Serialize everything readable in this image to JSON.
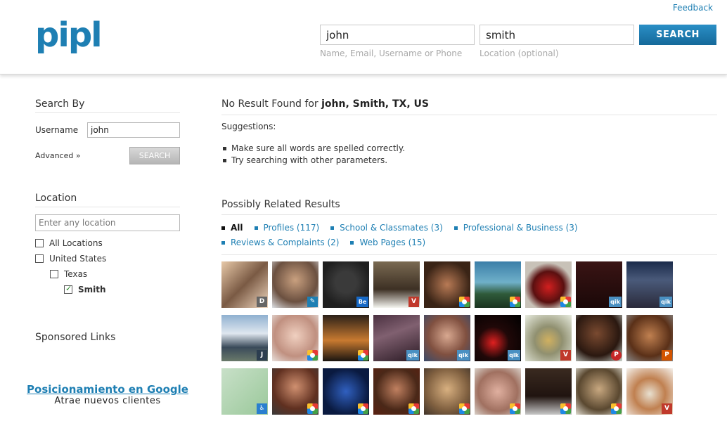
{
  "header": {
    "logo": "pipl",
    "feedback": "Feedback",
    "name_value": "john",
    "location_value": "smith",
    "name_hint": "Name, Email, Username or Phone",
    "location_hint": "Location (optional)",
    "search_label": "SEARCH"
  },
  "sidebar": {
    "search_by_title": "Search By",
    "username_label": "Username",
    "username_value": "john",
    "advanced_label": "Advanced »",
    "search_label": "SEARCH",
    "location_title": "Location",
    "location_placeholder": "Enter any location",
    "locations": [
      {
        "label": "All Locations",
        "checked": false
      },
      {
        "label": "United States",
        "checked": false
      },
      {
        "label": "Texas",
        "checked": false
      },
      {
        "label": "Smith",
        "checked": true
      }
    ],
    "sponsored_title": "Sponsored Links",
    "ad_title": "Posicionamiento en Google",
    "ad_text": "Atrae nuevos clientes"
  },
  "main": {
    "no_result_prefix": "No Result Found for ",
    "no_result_query": "john, Smith, TX, US",
    "suggestions_title": "Suggestions:",
    "suggestions": [
      "Make sure all words are spelled correctly.",
      "Try searching with other parameters."
    ],
    "related_title": "Possibly Related Results",
    "filters": [
      {
        "label": "All",
        "active": true
      },
      {
        "label": "Profiles (117)",
        "active": false
      },
      {
        "label": "School & Classmates (3)",
        "active": false
      },
      {
        "label": "Professional & Business (3)",
        "active": false
      },
      {
        "label": "Reviews & Complaints (2)",
        "active": false
      },
      {
        "label": "Web Pages (15)",
        "active": false
      }
    ]
  },
  "colors": {
    "brand": "#1e7fb3",
    "search_button": "#15699a"
  },
  "results": [
    {
      "badge": "d",
      "badge_text": "D"
    },
    {
      "badge": "pen",
      "badge_text": "✎"
    },
    {
      "badge": "be",
      "badge_text": "Be"
    },
    {
      "badge": "v",
      "badge_text": "V"
    },
    {
      "badge": "pic",
      "badge_text": ""
    },
    {
      "badge": "pic",
      "badge_text": ""
    },
    {
      "badge": "pic",
      "badge_text": ""
    },
    {
      "badge": "qik",
      "badge_text": "qik"
    },
    {
      "badge": "qik",
      "badge_text": "qik"
    },
    {
      "badge": "j",
      "badge_text": "J"
    },
    {
      "badge": "pic",
      "badge_text": ""
    },
    {
      "badge": "pic",
      "badge_text": ""
    },
    {
      "badge": "qik",
      "badge_text": "qik"
    },
    {
      "badge": "qik",
      "badge_text": "qik"
    },
    {
      "badge": "qik",
      "badge_text": "qik"
    },
    {
      "badge": "v",
      "badge_text": "V"
    },
    {
      "badge": "pin",
      "badge_text": "P"
    },
    {
      "badge": "p",
      "badge_text": "P"
    },
    {
      "badge": "acc",
      "badge_text": "♿"
    },
    {
      "badge": "pic",
      "badge_text": ""
    },
    {
      "badge": "pic",
      "badge_text": ""
    },
    {
      "badge": "pic",
      "badge_text": ""
    },
    {
      "badge": "pic",
      "badge_text": ""
    },
    {
      "badge": "pic",
      "badge_text": ""
    },
    {
      "badge": "pic",
      "badge_text": ""
    },
    {
      "badge": "pic",
      "badge_text": ""
    },
    {
      "badge": "v",
      "badge_text": "V"
    }
  ]
}
